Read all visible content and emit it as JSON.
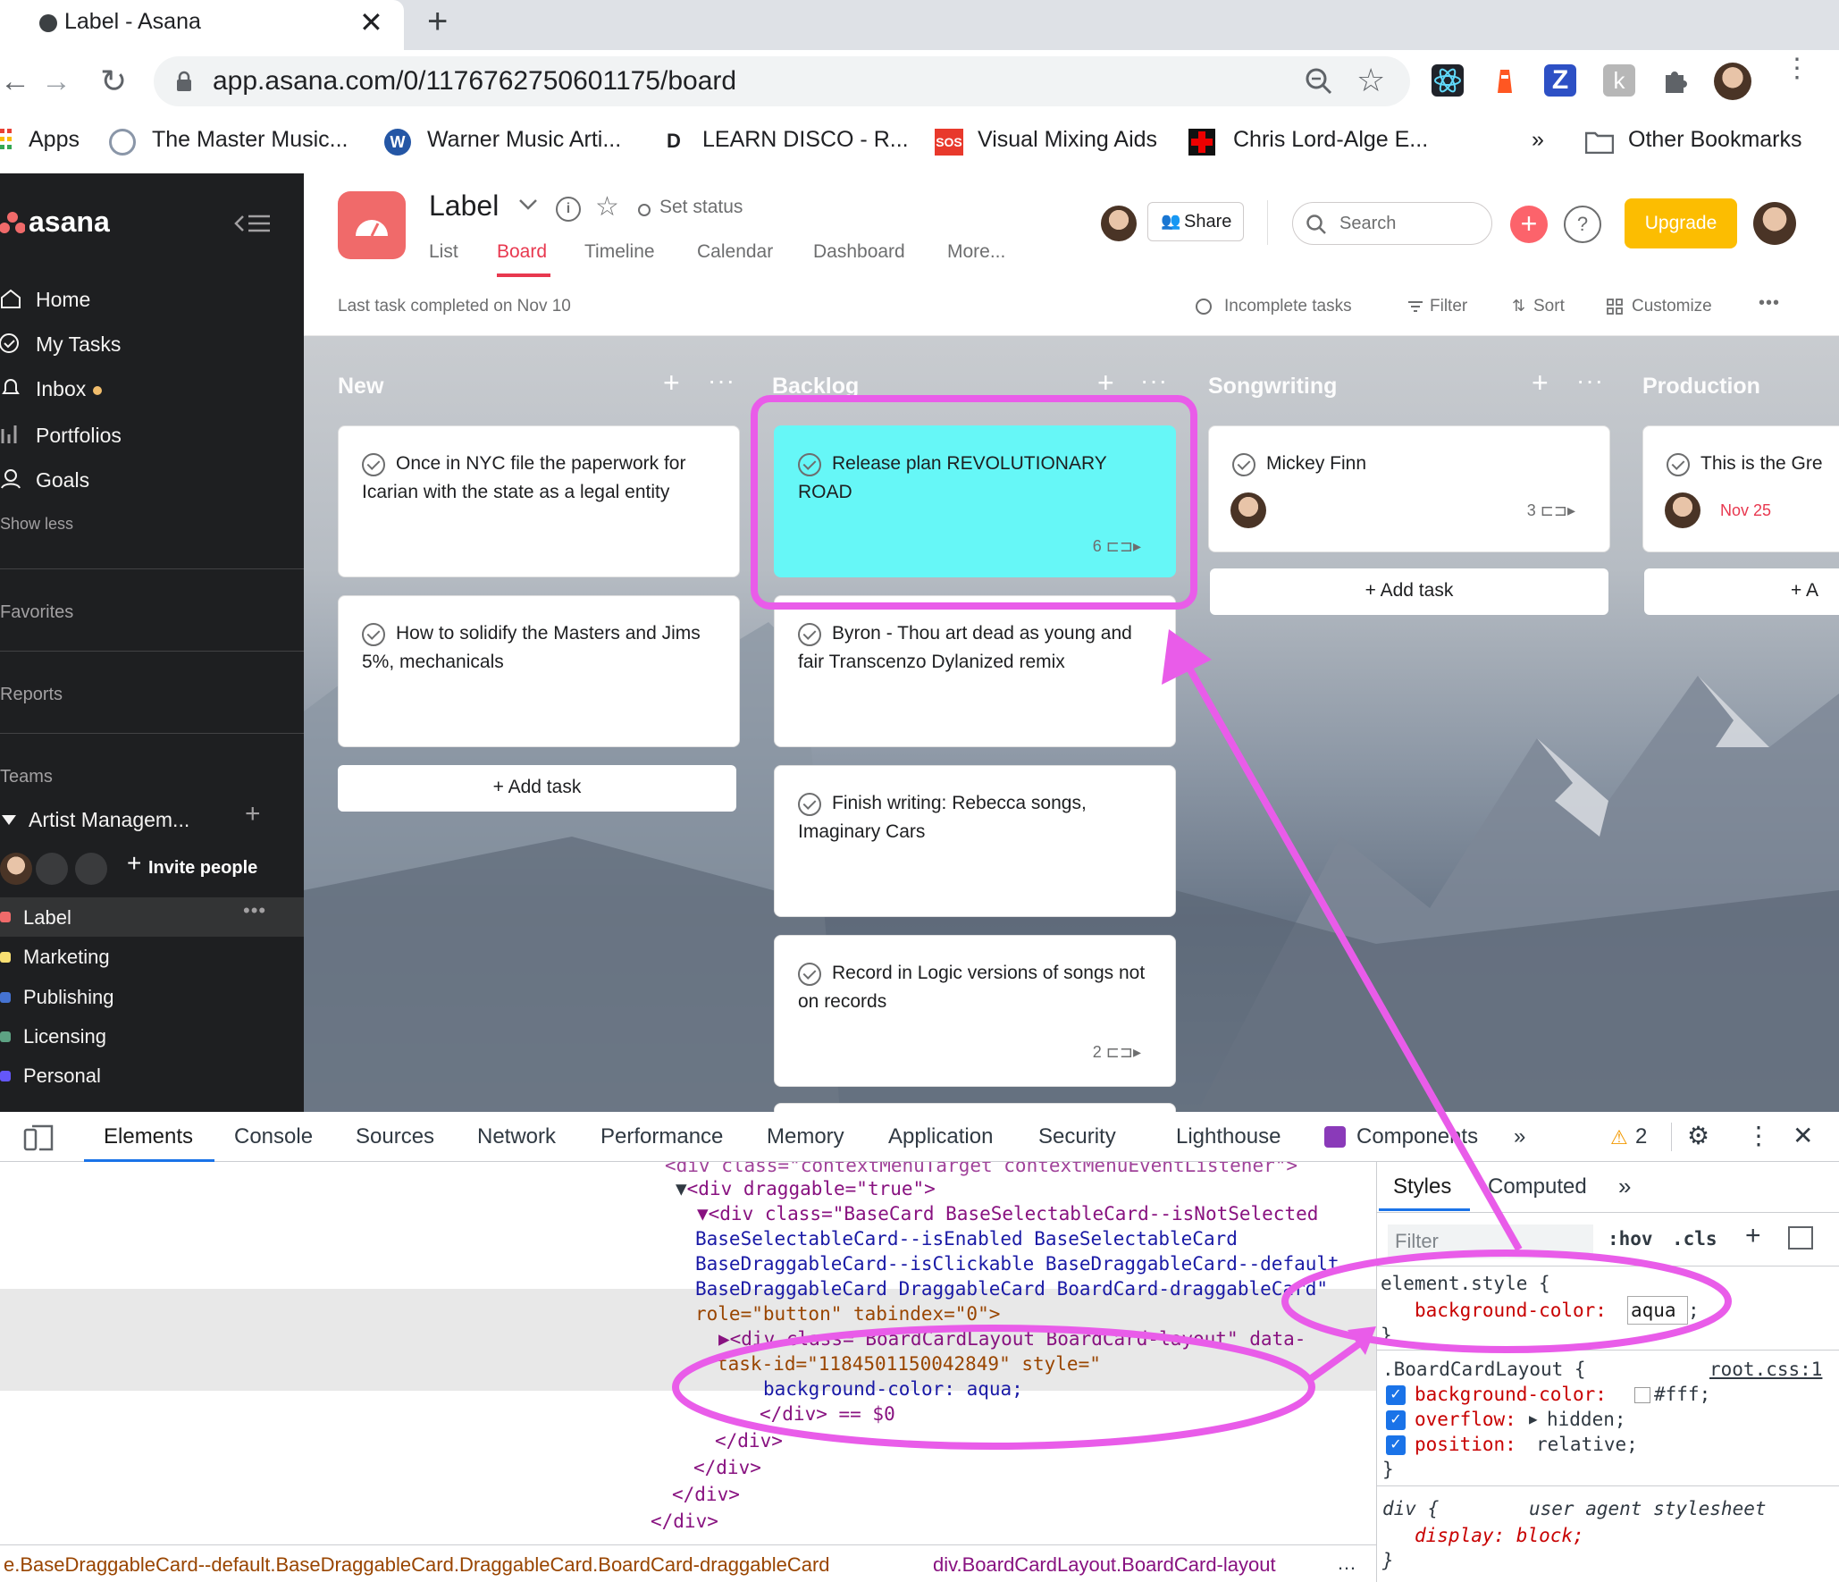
{
  "browser": {
    "tab_title": "Label - Asana",
    "url": "app.asana.com/0/1176762750601175/board",
    "bookmarks": [
      "Apps",
      "The Master Music...",
      "Warner Music Arti...",
      "LEARN DISCO - R...",
      "Visual Mixing Aids",
      "Chris Lord-Alge E...",
      "Other Bookmarks"
    ],
    "bookmark_letter_d": "D",
    "overflow": "»"
  },
  "sidebar": {
    "logo": "asana",
    "nav": [
      "Home",
      "My Tasks",
      "Inbox",
      "Portfolios",
      "Goals"
    ],
    "show_less": "Show less",
    "sections": [
      "Favorites",
      "Reports",
      "Teams"
    ],
    "team_name": "Artist Managem...",
    "invite": "Invite people",
    "projects": [
      {
        "name": "Label",
        "color": "#f06a6a"
      },
      {
        "name": "Marketing",
        "color": "#f8df72"
      },
      {
        "name": "Publishing",
        "color": "#4573d2"
      },
      {
        "name": "Licensing",
        "color": "#5da283"
      },
      {
        "name": "Personal",
        "color": "#6457f9"
      }
    ]
  },
  "header": {
    "project_title": "Label",
    "set_status": "Set status",
    "tabs": [
      "List",
      "Board",
      "Timeline",
      "Calendar",
      "Dashboard",
      "More..."
    ],
    "active_tab": "Board",
    "share": "Share",
    "search_placeholder": "Search",
    "help": "?",
    "upgrade": "Upgrade",
    "last_completed": "Last task completed on Nov 10",
    "incomplete": "Incomplete tasks",
    "filter": "Filter",
    "sort": "Sort",
    "customize": "Customize"
  },
  "board": {
    "add_task": "Add task",
    "columns": [
      {
        "name": "New",
        "cards": [
          {
            "title": "Once in NYC file the paperwork for Icarian with the state as a legal entity"
          },
          {
            "title": "How to solidify the Masters and Jims 5%, mechanicals"
          }
        ]
      },
      {
        "name": "Backlog",
        "cards": [
          {
            "title": "Release plan REVOLUTIONARY ROAD",
            "subtasks": "6"
          },
          {
            "title": "Byron - Thou art dead as young and fair Transcenzo Dylanized remix"
          },
          {
            "title": "Finish writing: Rebecca songs, Imaginary Cars"
          },
          {
            "title": "Record in Logic versions of songs not on records",
            "subtasks": "2"
          }
        ]
      },
      {
        "name": "Songwriting",
        "cards": [
          {
            "title": "Mickey Finn",
            "subtasks": "3"
          }
        ]
      },
      {
        "name": "Production",
        "cards": [
          {
            "title": "This is the Gre",
            "due": "Nov 25"
          }
        ]
      }
    ],
    "highlight_color": "#66f7f7",
    "annotation_color": "#e95ce9"
  },
  "devtools": {
    "tabs": [
      "Elements",
      "Console",
      "Sources",
      "Network",
      "Performance",
      "Memory",
      "Application",
      "Security",
      "Lighthouse",
      "Components"
    ],
    "active_tab": "Elements",
    "warnings": "2",
    "dom_lines": [
      "<div draggable=\"true\">",
      "▼<div class=\"BaseCard BaseSelectableCard--isNotSelected",
      "BaseSelectableCard--isEnabled BaseSelectableCard",
      "BaseDraggableCard--isClickable BaseDraggableCard--default",
      "BaseDraggableCard DraggableCard BoardCard-draggableCard\"",
      "role=\"button\" tabindex=\"0\">",
      "▶<div class=\"BoardCardLayout BoardCard-layout\" data-",
      "task-id=\"1184501150042849\" style=\"",
      "background-color: aqua;",
      "</div> == $0",
      "</div>",
      "</div>",
      "</div>",
      "</div>"
    ],
    "styles_tabs": [
      "Styles",
      "Computed"
    ],
    "filter_placeholder": "Filter",
    "hov": ":hov",
    "cls": ".cls",
    "element_style": "element.style {",
    "element_prop": "background-color:",
    "element_val": "aqua",
    "rule_selector": ".BoardCardLayout {",
    "rule_source": "root.css:1",
    "rule_props": [
      {
        "name": "background-color:",
        "value": "#fff;"
      },
      {
        "name": "overflow:",
        "value": "hidden;"
      },
      {
        "name": "position:",
        "value": "relative;"
      }
    ],
    "ua_selector": "div {",
    "ua_label": "user agent stylesheet",
    "ua_prop": "display: block;",
    "breadcrumb_left": "e.BaseDraggableCard--default.BaseDraggableCard.DraggableCard.BoardCard-draggableCard",
    "breadcrumb_right": "div.BoardCardLayout.BoardCard-layout"
  }
}
